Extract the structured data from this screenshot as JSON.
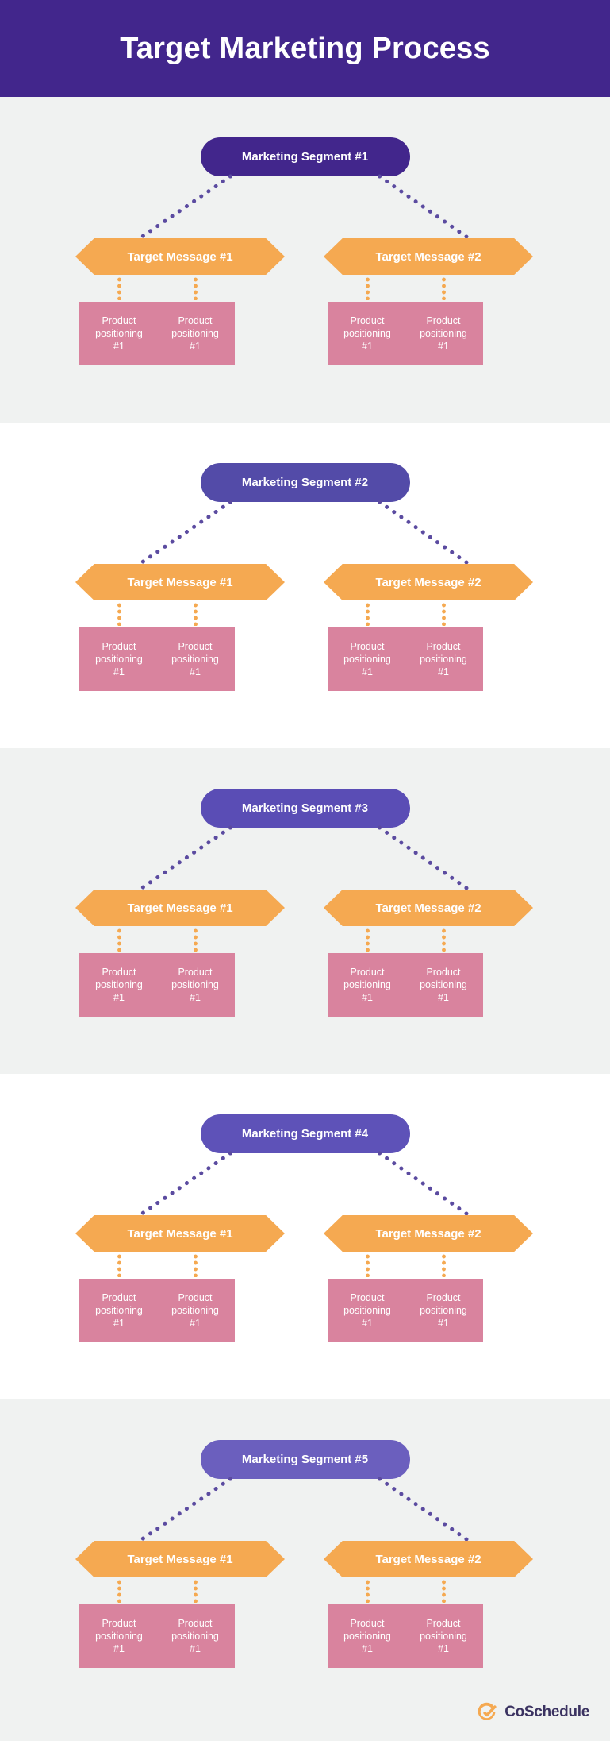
{
  "header": {
    "title": "Target Marketing Process",
    "bg_color": "#42268C",
    "text_color": "#ffffff"
  },
  "colors": {
    "section_shaded_bg": "#F0F2F1",
    "section_plain_bg": "#ffffff",
    "hexagon": "#F5A951",
    "product_box": "#D9839E",
    "connector_purple": "#5B4BA0",
    "connector_orange": "#F5A951",
    "logo_mark": "#F5A951",
    "logo_text": "#3B3361"
  },
  "labels": {
    "target_message_1": "Target Message #1",
    "target_message_2": "Target Message #2",
    "product_line_1": "Product",
    "product_line_2": "positioning",
    "product_line_3": "#1"
  },
  "sections": [
    {
      "background": "shaded",
      "segment": {
        "label": "Marketing Segment #1",
        "color": "#42268C"
      },
      "messages": [
        {
          "label": "Target Message #1",
          "boxes": [
            {
              "l1": "Product",
              "l2": "positioning",
              "l3": "#1"
            },
            {
              "l1": "Product",
              "l2": "positioning",
              "l3": "#1"
            }
          ]
        },
        {
          "label": "Target Message #2",
          "boxes": [
            {
              "l1": "Product",
              "l2": "positioning",
              "l3": "#1"
            },
            {
              "l1": "Product",
              "l2": "positioning",
              "l3": "#1"
            }
          ]
        }
      ]
    },
    {
      "background": "plain",
      "segment": {
        "label": "Marketing Segment #2",
        "color": "#534BA8"
      },
      "messages": [
        {
          "label": "Target Message #1",
          "boxes": [
            {
              "l1": "Product",
              "l2": "positioning",
              "l3": "#1"
            },
            {
              "l1": "Product",
              "l2": "positioning",
              "l3": "#1"
            }
          ]
        },
        {
          "label": "Target Message #2",
          "boxes": [
            {
              "l1": "Product",
              "l2": "positioning",
              "l3": "#1"
            },
            {
              "l1": "Product",
              "l2": "positioning",
              "l3": "#1"
            }
          ]
        }
      ]
    },
    {
      "background": "shaded",
      "segment": {
        "label": "Marketing Segment #3",
        "color": "#5A4DB5"
      },
      "messages": [
        {
          "label": "Target Message #1",
          "boxes": [
            {
              "l1": "Product",
              "l2": "positioning",
              "l3": "#1"
            },
            {
              "l1": "Product",
              "l2": "positioning",
              "l3": "#1"
            }
          ]
        },
        {
          "label": "Target Message #2",
          "boxes": [
            {
              "l1": "Product",
              "l2": "positioning",
              "l3": "#1"
            },
            {
              "l1": "Product",
              "l2": "positioning",
              "l3": "#1"
            }
          ]
        }
      ]
    },
    {
      "background": "plain",
      "segment": {
        "label": "Marketing Segment #4",
        "color": "#5E52B8"
      },
      "messages": [
        {
          "label": "Target Message #1",
          "boxes": [
            {
              "l1": "Product",
              "l2": "positioning",
              "l3": "#1"
            },
            {
              "l1": "Product",
              "l2": "positioning",
              "l3": "#1"
            }
          ]
        },
        {
          "label": "Target Message #2",
          "boxes": [
            {
              "l1": "Product",
              "l2": "positioning",
              "l3": "#1"
            },
            {
              "l1": "Product",
              "l2": "positioning",
              "l3": "#1"
            }
          ]
        }
      ]
    },
    {
      "background": "shaded",
      "segment": {
        "label": "Marketing Segment #5",
        "color": "#6B5FBE"
      },
      "messages": [
        {
          "label": "Target Message #1",
          "boxes": [
            {
              "l1": "Product",
              "l2": "positioning",
              "l3": "#1"
            },
            {
              "l1": "Product",
              "l2": "positioning",
              "l3": "#1"
            }
          ]
        },
        {
          "label": "Target Message #2",
          "boxes": [
            {
              "l1": "Product",
              "l2": "positioning",
              "l3": "#1"
            },
            {
              "l1": "Product",
              "l2": "positioning",
              "l3": "#1"
            }
          ]
        }
      ]
    }
  ],
  "footer": {
    "brand": "CoSchedule",
    "mark": "coschedule-check-icon"
  }
}
